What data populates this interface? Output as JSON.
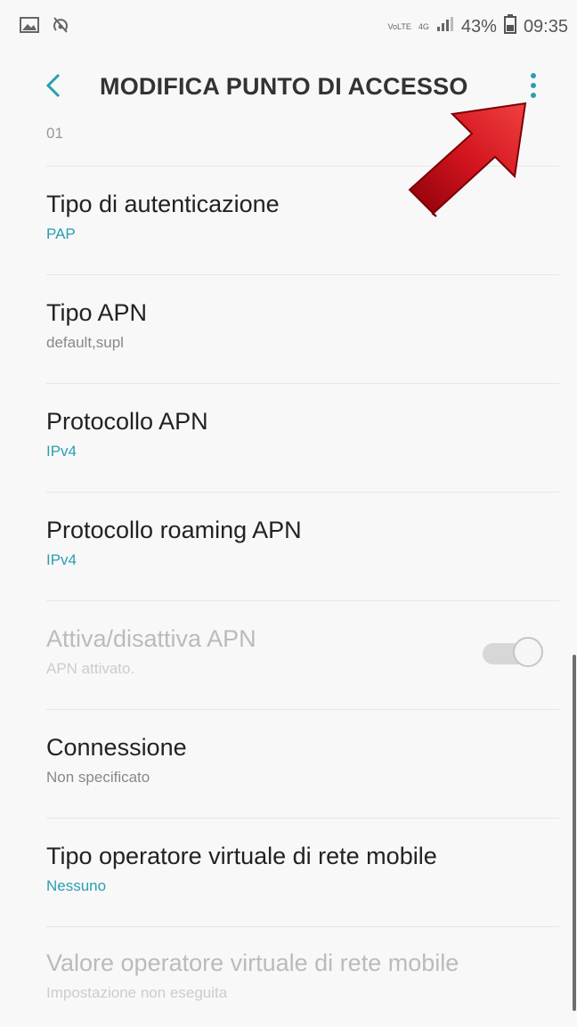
{
  "status_bar": {
    "left_icons": [
      "image-icon",
      "hotspot-icon"
    ],
    "network_small_1": "VoLTE",
    "network_small_2": "4G",
    "battery": "43%",
    "time": "09:35"
  },
  "app_bar": {
    "title": "MODIFICA PUNTO DI ACCESSO",
    "back_icon": "chevron-left-icon",
    "more_icon": "more-vert-icon"
  },
  "list": {
    "partial_value": "01",
    "items": [
      {
        "label": "Tipo di autenticazione",
        "value": "PAP"
      },
      {
        "label": "Tipo APN",
        "value": "default,supl"
      },
      {
        "label": "Protocollo APN",
        "value": "IPv4"
      },
      {
        "label": "Protocollo roaming APN",
        "value": "IPv4"
      },
      {
        "label": "Attiva/disattiva APN",
        "value": "APN attivato."
      },
      {
        "label": "Connessione",
        "value": "Non specificato"
      },
      {
        "label": "Tipo operatore virtuale di rete mobile",
        "value": "Nessuno"
      },
      {
        "label": "Valore operatore virtuale di rete mobile",
        "value": "Impostazione non eseguita"
      }
    ]
  },
  "colors": {
    "accent": "#2a9fb0",
    "arrow": "#c8101a"
  }
}
